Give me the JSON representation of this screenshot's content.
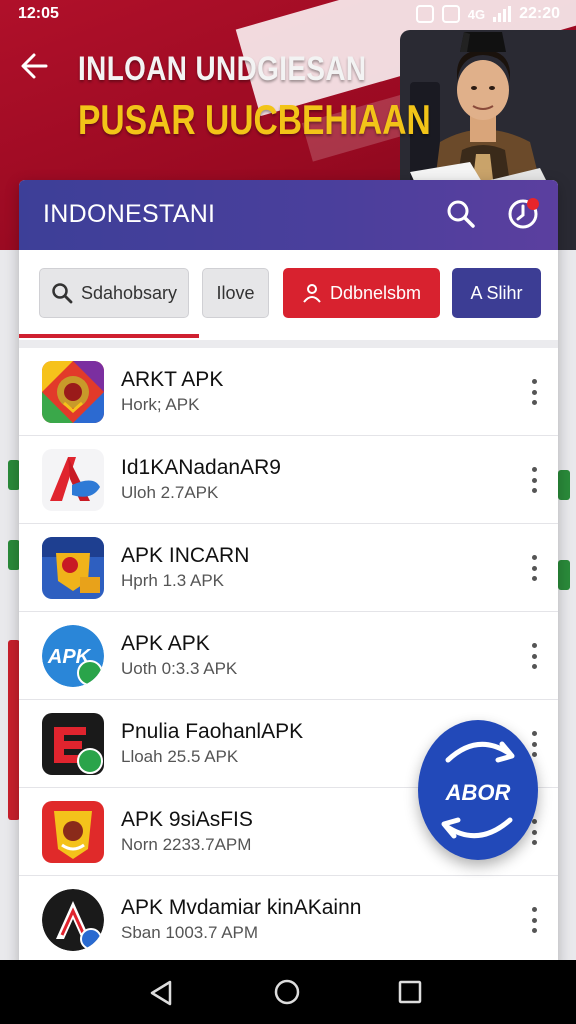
{
  "status_bar": {
    "time": "12:05",
    "network": "4G",
    "clock_right": "22:20"
  },
  "banner": {
    "title_line_1": "INLOAN UNDGIESAN",
    "title_line_2": "PUSAR UUCBEHIAAN"
  },
  "app_bar": {
    "title": "INDONESTANI"
  },
  "chips": {
    "search": "Sdahobsary",
    "more": "Ilove",
    "account": "Ddbnelsbm",
    "sort": "A Slihr"
  },
  "apps": [
    {
      "title": "ARKT APK",
      "subtitle": "Hork; APK"
    },
    {
      "title": "Id1KANadanAR9",
      "subtitle": "Uloh 2.7APK"
    },
    {
      "title": "APK INCARN",
      "subtitle": "Hprh 1.3 APK"
    },
    {
      "title": "APK APK",
      "subtitle": "Uoth 0:3.3 APK"
    },
    {
      "title": "Pnulia FaohanlAPK",
      "subtitle": "Lloah 25.5 APK"
    },
    {
      "title": "APK 9siAsFIS",
      "subtitle": "Norn 2233.7APM"
    },
    {
      "title": "APK Mvdamiar kinAKainn",
      "subtitle": "Sban 1003.7 APM"
    }
  ],
  "icons": {
    "app_icons": [
      "garuda-emblem-icon",
      "red-a-logo-icon",
      "emblem-shield-icon",
      "apk-circle-icon",
      "red-e-logo-icon",
      "red-mascot-icon",
      "black-a-logo-icon"
    ],
    "menu": "kebab-icon"
  },
  "fab": {
    "label": "ABOR"
  },
  "colors": {
    "banner_red": "#b0102a",
    "banner_yellow": "#f2c418",
    "app_bar_indigo": "#3d3f98",
    "chip_red": "#d8222f",
    "chip_indigo": "#3c3d94",
    "fab_blue": "#2249b9"
  }
}
